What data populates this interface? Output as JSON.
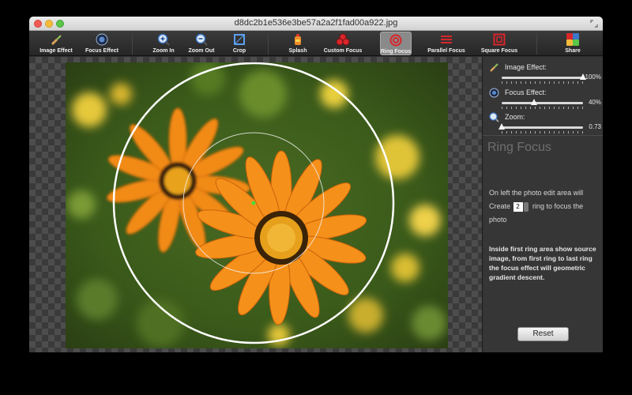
{
  "window": {
    "title": "d8dc2b1e536e3be57a2a2f1fad00a922.jpg"
  },
  "toolbar": {
    "items": [
      {
        "label": "Image Effect",
        "icon": "paint-brush-icon"
      },
      {
        "label": "Focus Effect",
        "icon": "lens-icon"
      },
      {
        "label": "Zoom In",
        "icon": "zoom-in-icon"
      },
      {
        "label": "Zoom Out",
        "icon": "zoom-out-icon"
      },
      {
        "label": "Crop",
        "icon": "crop-icon"
      },
      {
        "label": "Splash",
        "icon": "splash-bottle-icon"
      },
      {
        "label": "Custom Focus",
        "icon": "custom-focus-icon"
      },
      {
        "label": "Ring Focus",
        "icon": "ring-focus-icon"
      },
      {
        "label": "Parallel Focus",
        "icon": "parallel-focus-icon"
      },
      {
        "label": "Square Focus",
        "icon": "square-focus-icon"
      },
      {
        "label": "Share",
        "icon": "share-icon"
      }
    ],
    "active": "Ring Focus"
  },
  "sliders": {
    "image_effect": {
      "label": "Image Effect:",
      "value": "100%",
      "level": 1.0
    },
    "focus_effect": {
      "label": "Focus Effect:",
      "value": "40%",
      "level": 0.4
    },
    "zoom": {
      "label": "Zoom:",
      "value": "0.73",
      "level": 0.0
    }
  },
  "panel": {
    "title": "Ring Focus",
    "line1": "On left the photo edit area will",
    "create_word": "Create",
    "ring_count": "2",
    "line2_tail": "ring to focus the",
    "line3": "photo",
    "description": "Inside first ring area show source image, from first ring to last ring the focus effect will geometric gradient descent.",
    "reset_label": "Reset"
  },
  "colors": {
    "accent_red": "#d8262b",
    "panel_bg": "#363636",
    "toolbar_bg": "#2b2b2b"
  }
}
